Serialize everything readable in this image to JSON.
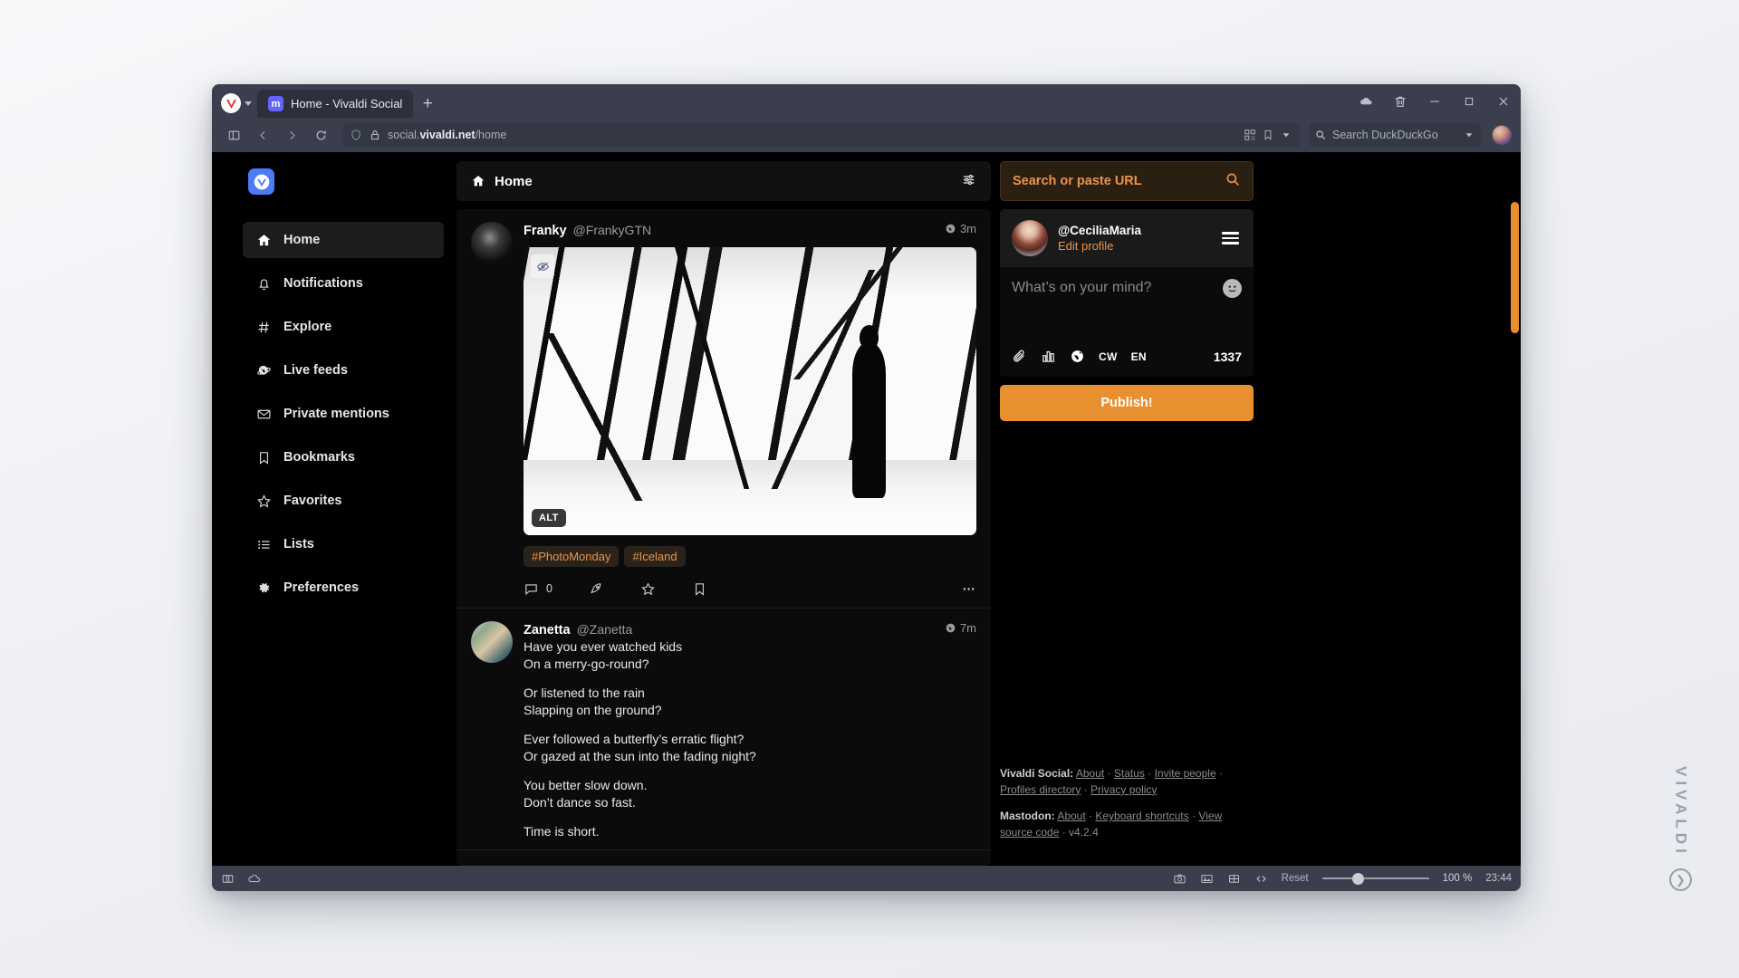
{
  "browser": {
    "tab": {
      "title": "Home - Vivaldi Social",
      "favicon_name": "mastodon-icon",
      "new_tab_label": "+"
    },
    "address_bar": {
      "url_prefix": "social.",
      "url_domain": "vivaldi.net",
      "url_path": "/home",
      "search_placeholder": "Search DuckDuckGo"
    },
    "window_controls": {
      "minimize": "–",
      "maximize": "□",
      "close": "✕"
    },
    "status_bar": {
      "reset_label": "Reset",
      "zoom_value": "100 %",
      "clock": "23:44"
    }
  },
  "page": {
    "nav": {
      "logo_name": "vivaldi-social-logo",
      "items": [
        {
          "label": "Home",
          "icon": "home-icon",
          "active": true
        },
        {
          "label": "Notifications",
          "icon": "bell-icon",
          "active": false
        },
        {
          "label": "Explore",
          "icon": "hash-icon",
          "active": false
        },
        {
          "label": "Live feeds",
          "icon": "globe-icon",
          "active": false
        },
        {
          "label": "Private mentions",
          "icon": "envelope-icon",
          "active": false
        },
        {
          "label": "Bookmarks",
          "icon": "bookmark-icon",
          "active": false
        },
        {
          "label": "Favorites",
          "icon": "star-icon",
          "active": false
        },
        {
          "label": "Lists",
          "icon": "list-icon",
          "active": false
        },
        {
          "label": "Preferences",
          "icon": "gear-icon",
          "active": false
        }
      ]
    },
    "column_header": {
      "title": "Home",
      "icon": "home-icon"
    },
    "statuses": [
      {
        "display_name": "Franky",
        "handle": "@FrankyGTN",
        "time": "3m",
        "media": {
          "alt_badge": "ALT",
          "description": "Black and white photo of a person silhouetted against large angular glass windows"
        },
        "tags": [
          "#PhotoMonday",
          "#Iceland"
        ],
        "reply_count": "0"
      },
      {
        "display_name": "Zanetta",
        "handle": "@Zanetta",
        "time": "7m",
        "lines": [
          "Have you ever watched kids",
          "On a merry-go-round?",
          "",
          "Or listened to the rain",
          "Slapping on the ground?",
          "",
          "Ever followed a butterfly’s erratic flight?",
          "Or gazed at the sun into the fading night?",
          "",
          "You better slow down.",
          "Don’t dance so fast.",
          "",
          "Time is short."
        ]
      }
    ],
    "search": {
      "placeholder": "Search or paste URL"
    },
    "compose": {
      "handle": "@CeciliaMaria",
      "edit_profile_label": "Edit profile",
      "placeholder": "What’s on your mind?",
      "cw_label": "CW",
      "lang_label": "EN",
      "char_count": "1337",
      "publish_label": "Publish!"
    },
    "footer": {
      "line1_label": "Vivaldi Social:",
      "line1_links": [
        "About",
        "Status",
        "Invite people",
        "Profiles directory",
        "Privacy policy"
      ],
      "line2_label": "Mastodon:",
      "line2_links": [
        "About",
        "Keyboard shortcuts",
        "View source code"
      ],
      "version": "v4.2.4",
      "sep": " · "
    }
  },
  "desktop": {
    "watermark": "VIVALDI"
  },
  "colors": {
    "accent_orange": "#e8902f",
    "tag_orange": "#e8954a",
    "chrome_gray": "#3b3f4d",
    "page_black": "#000000"
  }
}
